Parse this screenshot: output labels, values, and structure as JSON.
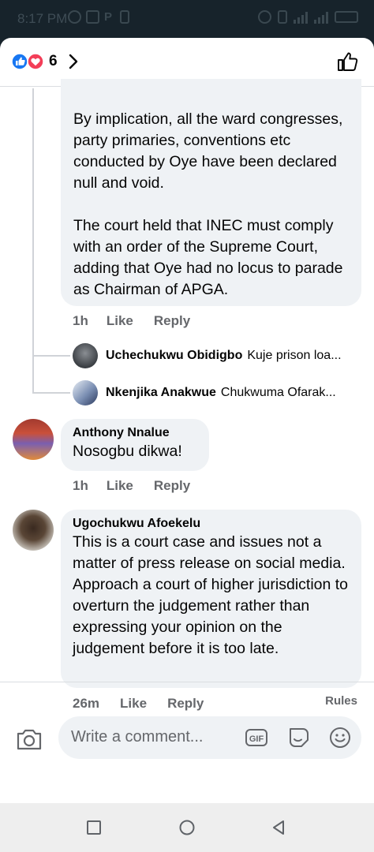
{
  "status_bar": {
    "time": "8:17 PM"
  },
  "header": {
    "reaction_count": "6"
  },
  "comments": {
    "reply_block": {
      "text": "By implication, all the ward congresses, party primaries, conventions etc conducted by Oye have been declared null and void.\n\nThe court held that INEC must comply with an order of the Supreme Court, adding that Oye had no locus to parade as Chairman of APGA.",
      "time": "1h",
      "like": "Like",
      "reply": "Reply"
    },
    "collapsed_replies": [
      {
        "name": "Uchechukwu Obidigbo",
        "preview": "Kuje prison loa..."
      },
      {
        "name": "Nkenjika Anakwue",
        "preview": "Chukwuma Ofarak..."
      }
    ],
    "anthony": {
      "name": "Anthony Nnalue",
      "text": "Nosogbu dikwa!",
      "time": "1h",
      "like": "Like",
      "reply": "Reply"
    },
    "ugochukwu": {
      "name": "Ugochukwu Afoekelu",
      "text": "This is a court case and issues not a matter of press release on social media. Approach a court of higher jurisdiction to overturn the judgement rather than expressing your opinion on the judgement before it is too late.",
      "time": "26m",
      "like": "Like",
      "reply": "Reply"
    }
  },
  "composer": {
    "rules": "Rules",
    "placeholder": "Write a comment...",
    "icons": [
      "camera-icon",
      "gif-icon",
      "sticker-icon",
      "emoji-icon"
    ]
  },
  "navbar": {
    "icons": [
      "recents-icon",
      "home-icon",
      "back-icon"
    ]
  },
  "colors": {
    "like_blue": "#1877f2",
    "love_red": "#f33e58",
    "bubble": "#eff2f5",
    "meta_gray": "#65676b"
  }
}
